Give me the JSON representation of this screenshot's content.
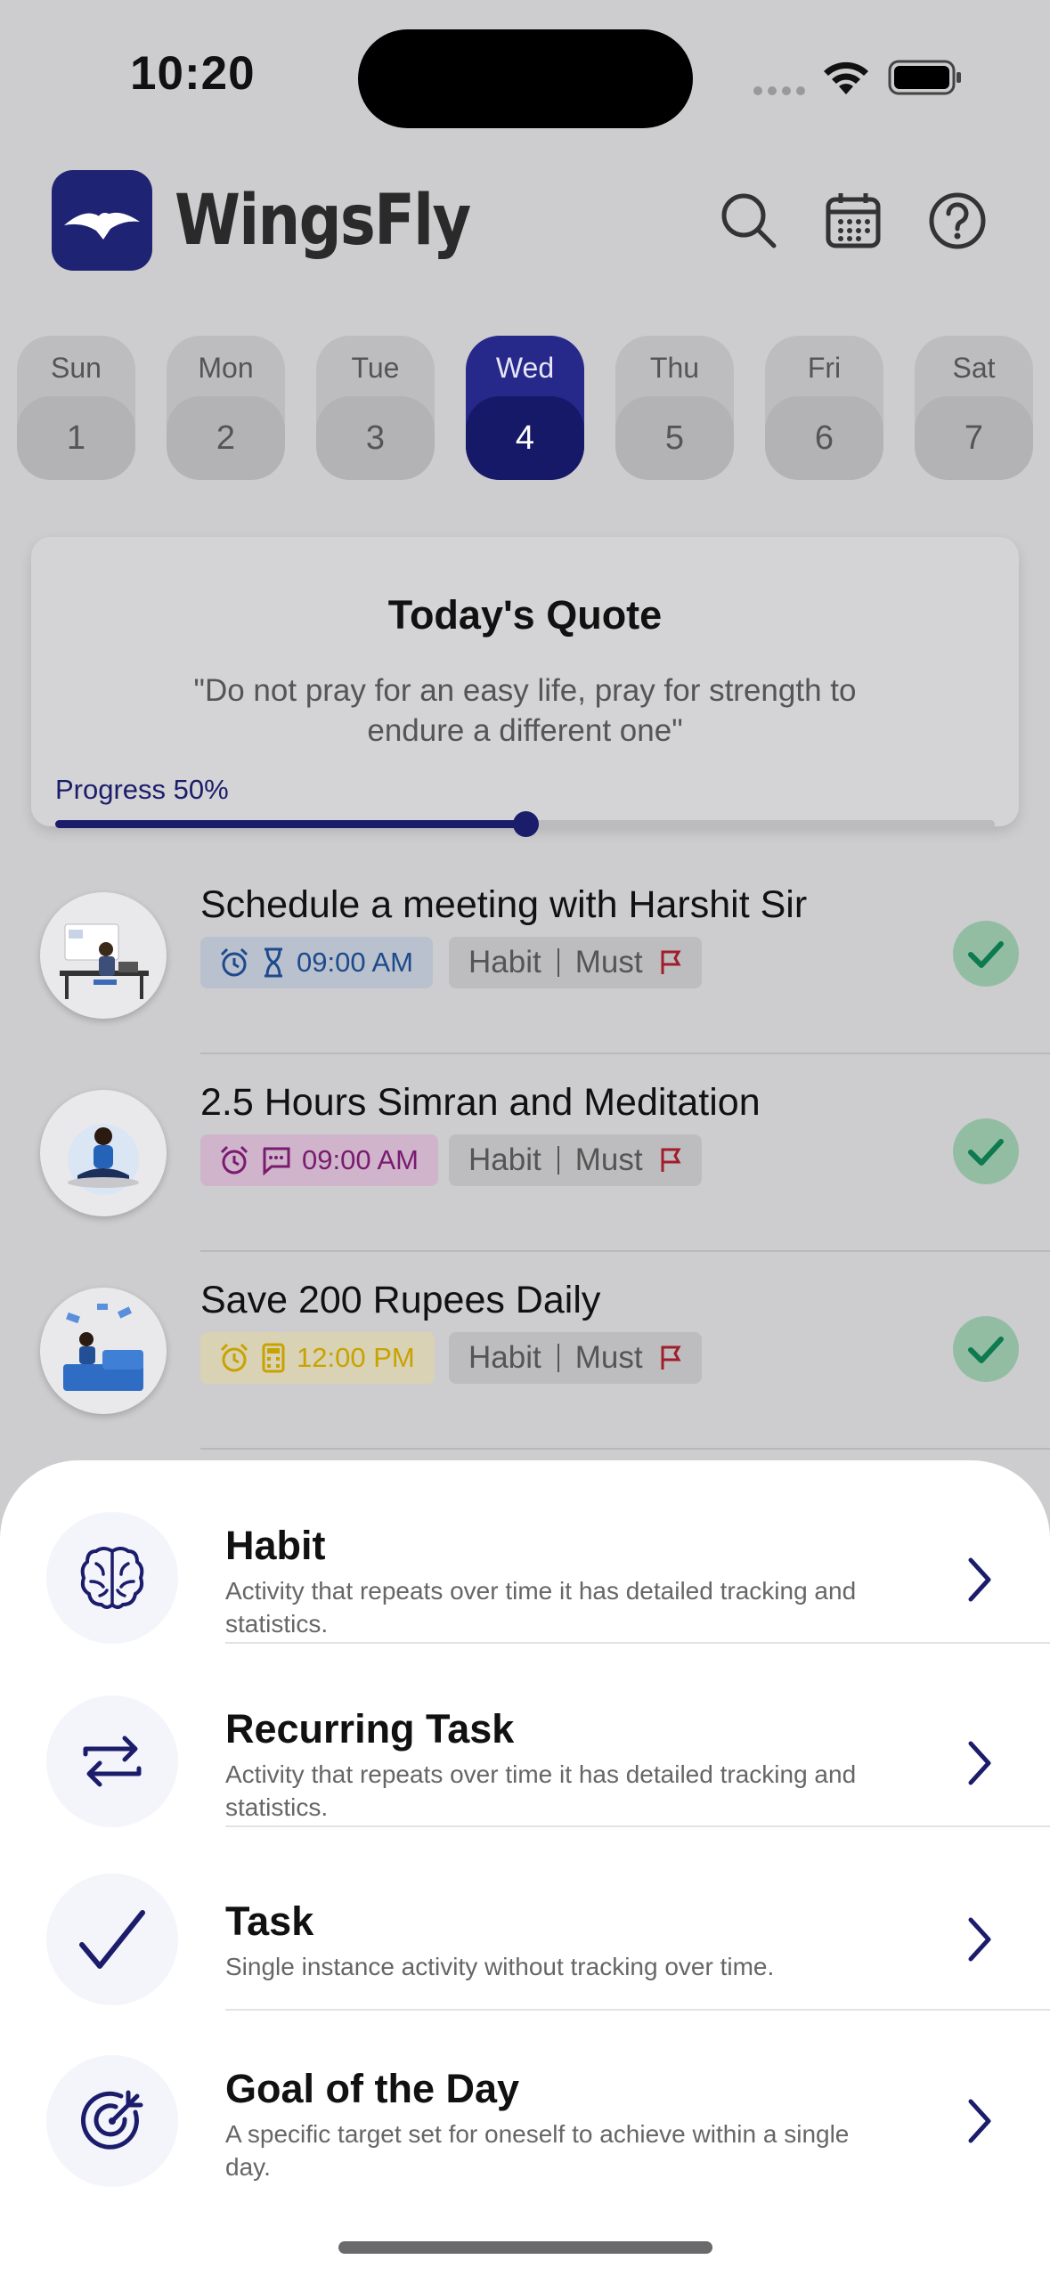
{
  "status_bar": {
    "time": "10:20"
  },
  "header": {
    "brand": "WingsFly"
  },
  "week": [
    {
      "day": "Sun",
      "date": "1"
    },
    {
      "day": "Mon",
      "date": "2"
    },
    {
      "day": "Tue",
      "date": "3"
    },
    {
      "day": "Wed",
      "date": "4",
      "active": true
    },
    {
      "day": "Thu",
      "date": "5"
    },
    {
      "day": "Fri",
      "date": "6"
    },
    {
      "day": "Sat",
      "date": "7"
    }
  ],
  "quote": {
    "title": "Today's Quote",
    "text": "\"Do not pray for an easy life, pray for strength to endure a different one\"",
    "progress_label": "Progress 50%",
    "progress": 0.5
  },
  "tasks": [
    {
      "title": "Schedule a meeting with Harshit Sir",
      "time": "09:00 AM",
      "type": "Habit",
      "priority": "Must",
      "time_color": "#1e4a8c",
      "time_bg": "#b8c1cd",
      "secondary_icon": "hourglass-icon"
    },
    {
      "title": "2.5 Hours Simran and Meditation",
      "time": "09:00 AM",
      "type": "Habit",
      "priority": "Must",
      "time_color": "#7a1b6f",
      "time_bg": "#cfb4cb",
      "secondary_icon": "message-icon"
    },
    {
      "title": "Save 200 Rupees Daily",
      "time": "12:00 PM",
      "type": "Habit",
      "priority": "Must",
      "time_color": "#c8a300",
      "time_bg": "#d9d2b4",
      "secondary_icon": "calculator-icon"
    }
  ],
  "sheet": {
    "options": [
      {
        "title": "Habit",
        "desc": "Activity that repeats over time it has detailed tracking and statistics.",
        "icon": "brain-icon"
      },
      {
        "title": "Recurring Task",
        "desc": "Activity that repeats over time it has detailed tracking and statistics.",
        "icon": "repeat-icon"
      },
      {
        "title": "Task",
        "desc": "Single instance activity without tracking over time.",
        "icon": "checkmark-icon"
      },
      {
        "title": "Goal of the Day",
        "desc": "A specific target set for oneself to achieve within a single day.",
        "icon": "target-icon"
      }
    ]
  },
  "colors": {
    "brand": "#1b1d6b",
    "check": "#0d7a4f",
    "flag": "#a11d2b"
  }
}
